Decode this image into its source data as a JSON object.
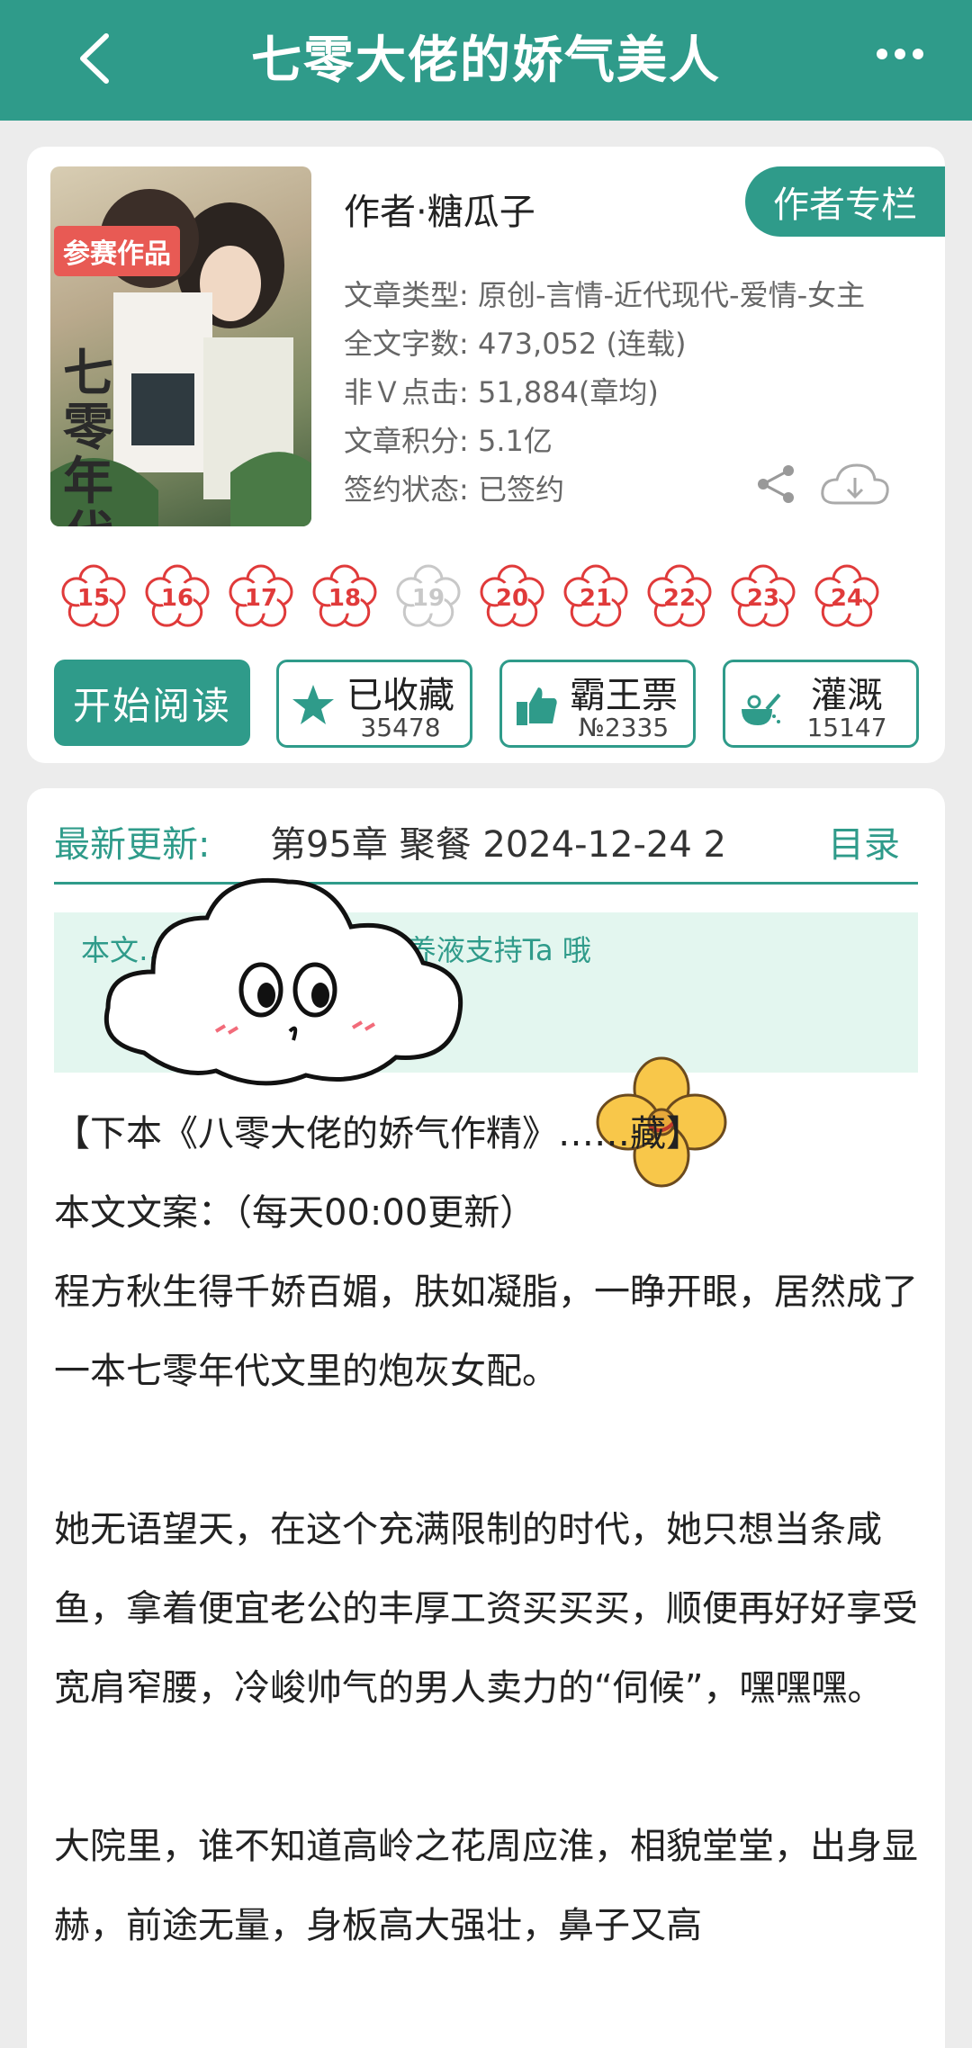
{
  "header": {
    "title": "七零大佬的娇气美人"
  },
  "book": {
    "cover_tag": "参赛作品",
    "cover_title": "七零年代大佬的",
    "author": "作者·糖瓜子",
    "author_column": "作者专栏",
    "info": [
      "文章类型: 原创-言情-近代现代-爱情-女主",
      "全文字数: 473,052 (连载)",
      "非Ｖ点击: 51,884(章均)",
      "文章积分: 5.1亿",
      "签约状态: 已签约"
    ]
  },
  "flowers": [
    "15",
    "16",
    "17",
    "18",
    "19",
    "20",
    "21",
    "22",
    "23",
    "24"
  ],
  "actions": {
    "read": "开始阅读",
    "collect": {
      "label": "已收藏",
      "count": "35478"
    },
    "ticket": {
      "label": "霸王票",
      "count": "№2335"
    },
    "water": {
      "label": "灌溉",
      "count": "15147"
    }
  },
  "latest": {
    "label": "最新更新:",
    "chapter": "第95章  聚餐  2024-12-24 2",
    "toc": "目录"
  },
  "notice": "本文……作品，快投雷/营养液支持Ta 哦",
  "content": [
    "【下本《八零大佬的娇气作精》……藏】",
    "本文文案：（每天00:00更新）",
    "程方秋生得千娇百媚，肤如凝脂，一睁开眼，居然成了一本七零年代文里的炮灰女配。",
    "",
    "她无语望天，在这个充满限制的时代，她只想当条咸鱼，拿着便宜老公的丰厚工资买买买，顺便再好好享受宽肩窄腰，冷峻帅气的男人卖力的“伺候”，嘿嘿嘿。",
    "",
    "大院里，谁不知道高岭之花周应淮，相貌堂堂，出身显赫，前途无量，身板高大强壮，鼻子又高"
  ]
}
